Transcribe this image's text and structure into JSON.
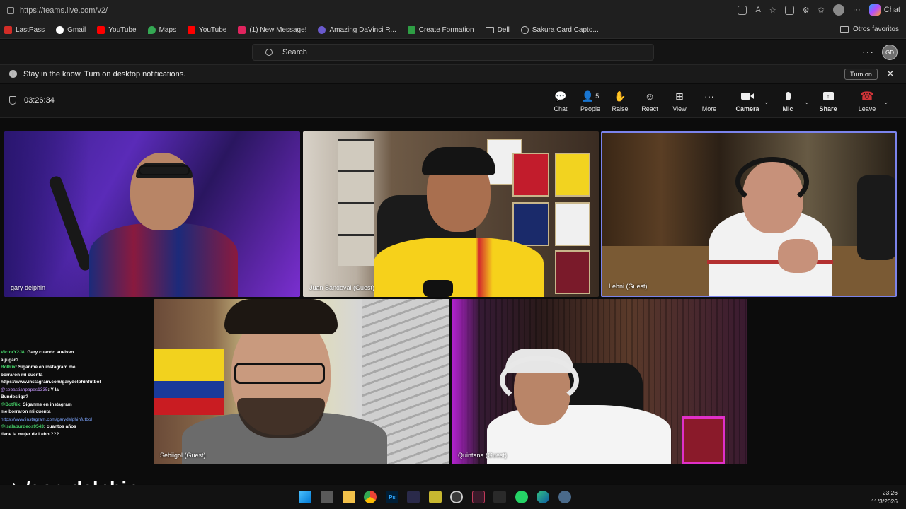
{
  "browser": {
    "url": "https://teams.live.com/v2/",
    "chat_label": "Chat"
  },
  "bookmarks": {
    "items": [
      {
        "label": "LastPass",
        "color": "#d32d27"
      },
      {
        "label": "Gmail",
        "color": "#ea4335"
      },
      {
        "label": "YouTube",
        "color": "#ff0000"
      },
      {
        "label": "Maps",
        "color": "#34a853"
      },
      {
        "label": "YouTube",
        "color": "#ff0000"
      },
      {
        "label": "(1) New Message!",
        "color": "#e0245e"
      },
      {
        "label": "Amazing DaVinci R...",
        "color": "#6a5acd"
      },
      {
        "label": "Create Formation",
        "color": "#2e9e44"
      },
      {
        "label": "Dell",
        "color": "#bbbbbb"
      },
      {
        "label": "Sakura Card Capto...",
        "color": "#bbbbbb"
      }
    ],
    "other": "Otros favoritos"
  },
  "teams": {
    "search_placeholder": "Search",
    "avatar_initials": "GD",
    "notification": "Stay in the know. Turn on desktop notifications.",
    "turn_on_label": "Turn on"
  },
  "meeting": {
    "timer": "03:26:34",
    "people_count": "5",
    "controls": {
      "chat": "Chat",
      "people": "People",
      "raise": "Raise",
      "react": "React",
      "view": "View",
      "more": "More",
      "camera": "Camera",
      "mic": "Mic",
      "share": "Share",
      "leave": "Leave"
    },
    "leave_color": "#d13438",
    "active_speaker_color": "#7b83eb"
  },
  "participants": [
    {
      "name": "gary delphin"
    },
    {
      "name": "Juan Sandoval (Guest)"
    },
    {
      "name": "Lebni (Guest)"
    },
    {
      "name": "Sebiigol (Guest)"
    },
    {
      "name": "Quintana (Guest)"
    }
  ],
  "chat_overlay": [
    {
      "user": "VictorY2J8",
      "text": ": Gary cuando vuelven a jugar?"
    },
    {
      "user": "BotRix",
      "text": ": Siganme en instagram me borraron mi cuenta https://www.instagram.com/garydelphinfutbol"
    },
    {
      "user": "@sebastianpapes1335",
      "text": ": Y la Bundesliga?"
    },
    {
      "user": "@BotRix",
      "text": ": Siganme en instagram me borraron mi cuenta"
    },
    {
      "user": "",
      "text": "https://www.instagram.com/garydelphinfutbol"
    },
    {
      "user": "@isalaburdeos9543",
      "text": ": cuantos años tiene la mujer de Lebni???"
    }
  ],
  "watermark": "/garydelphin",
  "clock": {
    "time": "23:26",
    "date": "11/3/2026"
  }
}
